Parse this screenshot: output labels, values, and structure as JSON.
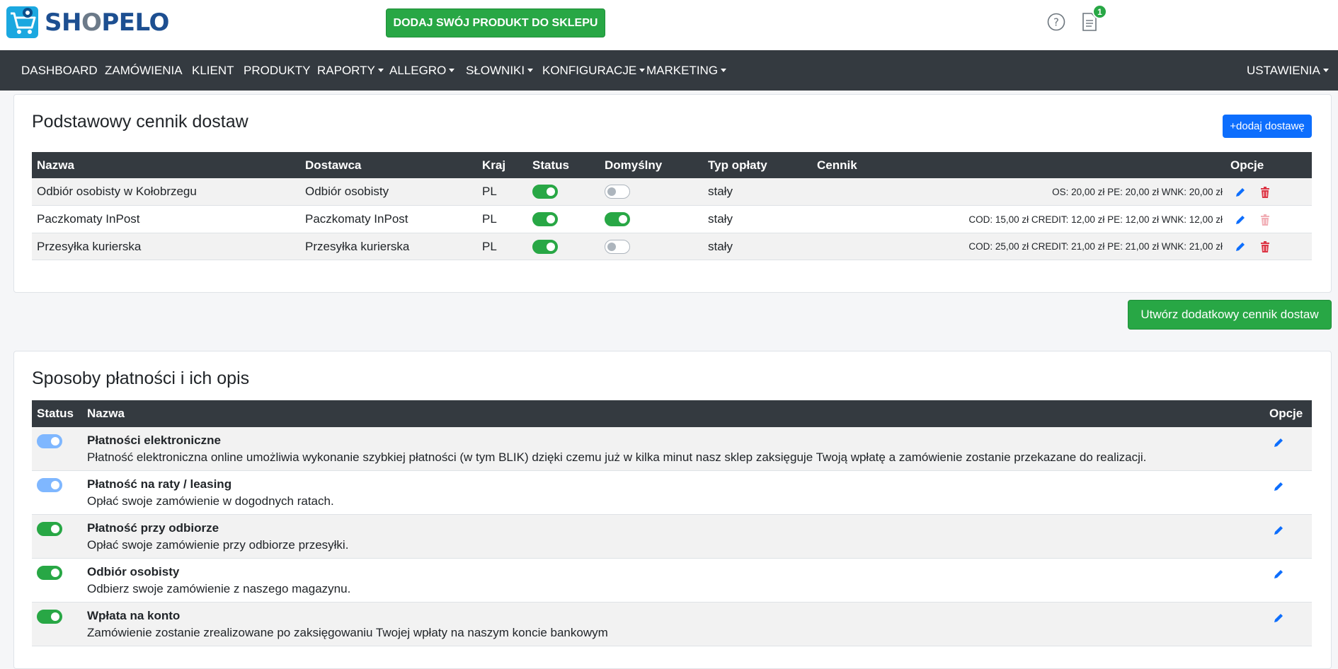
{
  "header": {
    "logo_text_1": "SH",
    "logo_text_2": "O",
    "logo_text_3": "PELO",
    "cta_label": "DODAJ SWÓJ PRODUKT DO SKLEPU",
    "notifications_count": "1",
    "icons": [
      "cart-logo-icon",
      "help-icon",
      "document-icon"
    ]
  },
  "nav": {
    "items": [
      {
        "label": "DASHBOARD",
        "dropdown": false
      },
      {
        "label": "ZAMÓWIENIA",
        "dropdown": false
      },
      {
        "label": "KLIENT",
        "dropdown": false
      },
      {
        "label": "PRODUKTY",
        "dropdown": false
      },
      {
        "label": "RAPORTY",
        "dropdown": true
      },
      {
        "label": "ALLEGRO",
        "dropdown": true
      },
      {
        "label": "SŁOWNIKI",
        "dropdown": true
      },
      {
        "label": "KONFIGURACJE",
        "dropdown": true
      },
      {
        "label": "MARKETING",
        "dropdown": true
      }
    ],
    "settings": {
      "label": "USTAWIENIA",
      "dropdown": true
    }
  },
  "delivery": {
    "title": "Podstawowy cennik dostaw",
    "add_button": "+dodaj dostawę",
    "columns": [
      "Nazwa",
      "Dostawca",
      "Kraj",
      "Status",
      "Domyślny",
      "Typ opłaty",
      "Cennik",
      "Opcje"
    ],
    "rows": [
      {
        "name": "Odbiór osobisty w Kołobrzegu",
        "supplier": "Odbiór osobisty",
        "country": "PL",
        "status": true,
        "default": false,
        "fee_type": "stały",
        "prices": "OS: 20,00 zł PE: 20,00 zł WNK: 20,00 zł",
        "delete_enabled": true
      },
      {
        "name": "Paczkomaty InPost",
        "supplier": "Paczkomaty InPost",
        "country": "PL",
        "status": true,
        "default": true,
        "fee_type": "stały",
        "prices": "COD: 15,00 zł CREDIT: 12,00 zł PE: 12,00 zł WNK: 12,00 zł",
        "delete_enabled": false
      },
      {
        "name": "Przesyłka kurierska",
        "supplier": "Przesyłka kurierska",
        "country": "PL",
        "status": true,
        "default": false,
        "fee_type": "stały",
        "prices": "COD: 25,00 zł CREDIT: 21,00 zł PE: 21,00 zł WNK: 21,00 zł",
        "delete_enabled": true
      }
    ],
    "create_button": "Utwórz dodatkowy cennik dostaw"
  },
  "payments": {
    "title": "Sposoby płatności i ich opis",
    "columns": [
      "Status",
      "Nazwa",
      "Opcje"
    ],
    "rows": [
      {
        "name": "Płatności elektroniczne",
        "description": "Płatność elektroniczna online umożliwia wykonanie szybkiej płatności (w tym BLIK) dzięki czemu już w kilka minut nasz sklep zaksięguje Twoją wpłatę a zamówienie zostanie przekazane do realizacji.",
        "status": "light"
      },
      {
        "name": "Płatność na raty / leasing",
        "description": "Opłać swoje zamówienie w dogodnych ratach.",
        "status": "light"
      },
      {
        "name": "Płatność przy odbiorze",
        "description": "Opłać swoje zamówienie przy odbiorze przesyłki.",
        "status": "on"
      },
      {
        "name": "Odbiór osobisty",
        "description": "Odbierz swoje zamówienie z naszego magazynu.",
        "status": "on"
      },
      {
        "name": "Wpłata na konto",
        "description": "Zamówienie zostanie zrealizowane po zaksięgowaniu Twojej wpłaty na naszym koncie bankowym",
        "status": "on"
      }
    ]
  },
  "colors": {
    "navbar": "#343a40",
    "success": "#28a745",
    "primary": "#0d6efd",
    "danger": "#dc3545"
  }
}
